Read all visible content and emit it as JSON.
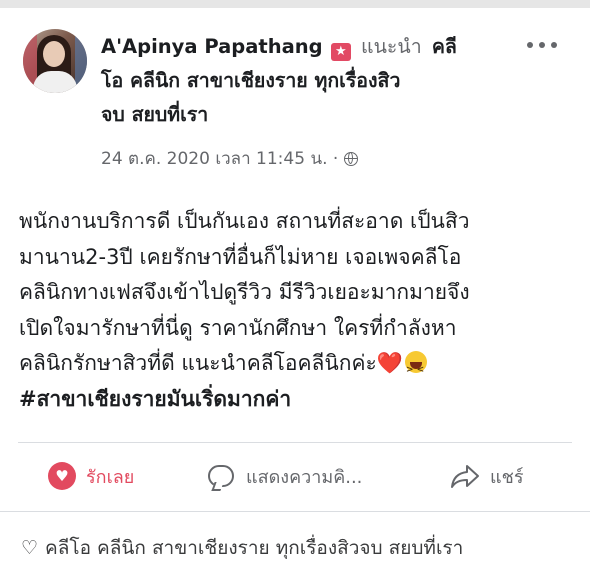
{
  "post": {
    "author": "A'Apinya Papathang",
    "recommends_label": "แนะนำ",
    "page_name_line1": "คลี",
    "page_name_line2": "โอ คลีนิก สาขาเชียงราย ทุกเรื่องสิว",
    "page_name_line3": "จบ สยบที่เรา",
    "timestamp": "24 ต.ค. 2020 เวลา 11:45 น.",
    "separator": "·",
    "body_lines": [
      "พนักงานบริการดี เป็นกันเอง สถานที่สะอาด เป็นสิว",
      "มานาน2-3ปี เคยรักษาที่อื่นก็ไม่หาย เจอเพจคลีโอ",
      "คลินิกทางเฟสจึงเข้าไปดูรีวิว มีรีวิวเยอะมากมายจึง",
      "เปิดใจมารักษาที่นี่ดู ราคานักศึกษา ใครที่กำลังหา",
      "คลินิกรักษาสิวที่ดี แนะนำคลีโอคลีนิกค่ะ"
    ],
    "hashtag": "#สาขาเชียงรายมันเริ่ดมากค่า",
    "heart_emoji": "❤️"
  },
  "actions": {
    "like_label": "รักเลย",
    "comment_label": "แสดงความคิ...",
    "share_label": "แชร์"
  },
  "footer": {
    "page_label": "คลีโอ คลีนิก สาขาเชียงราย ทุกเรื่องสิวจบ สยบที่เรา"
  },
  "icons": {
    "recommend": "recommend-badge-icon",
    "privacy": "globe-icon",
    "more": "more-options-icon",
    "like": "heart-icon",
    "comment": "comment-bubble-icon",
    "share": "share-arrow-icon",
    "footer": "heart-outline-icon"
  },
  "colors": {
    "like_accent": "#e24a5f",
    "secondary_text": "#65676b",
    "primary_text": "#1c1e21"
  }
}
